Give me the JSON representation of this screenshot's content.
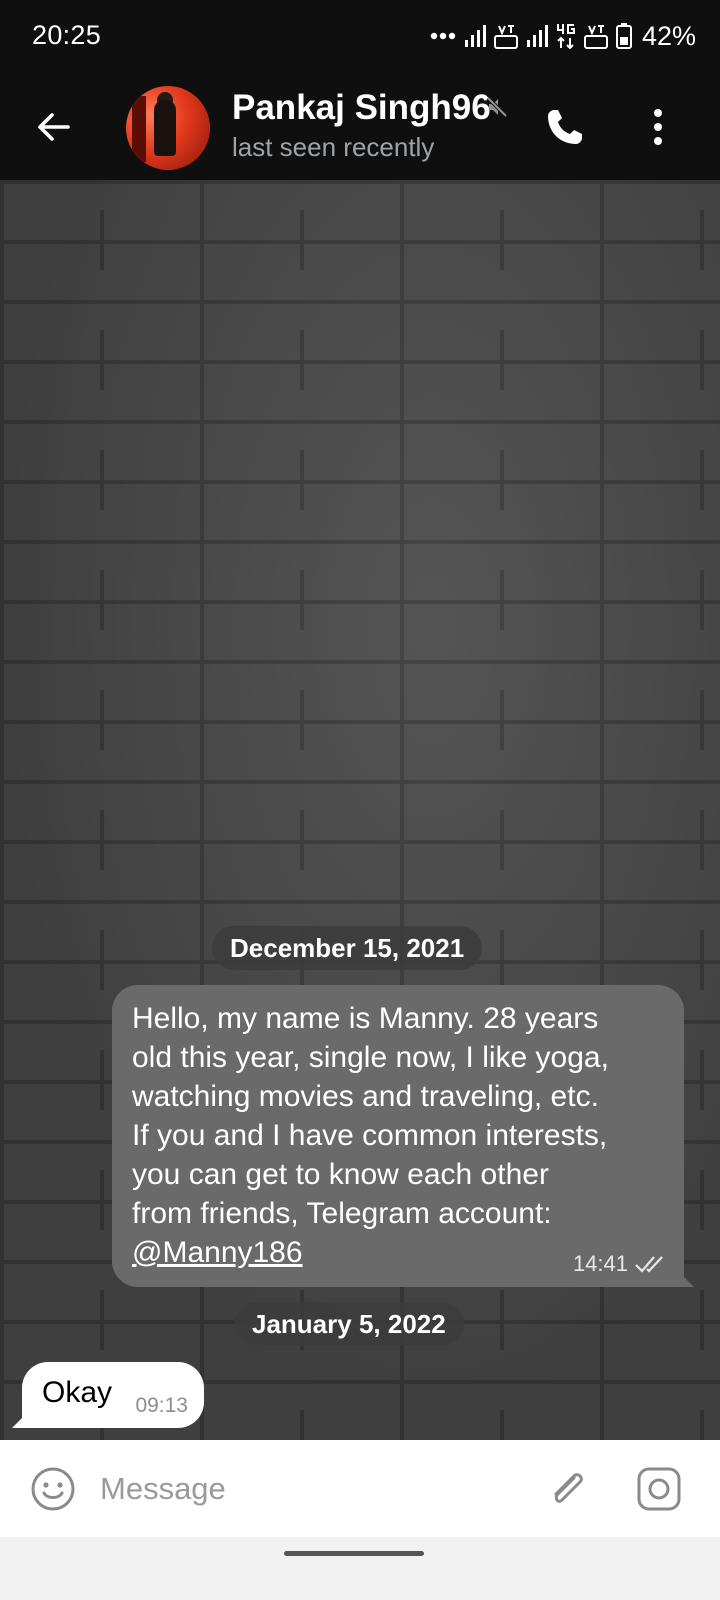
{
  "status_bar": {
    "time": "20:25",
    "battery": "42%",
    "icons": [
      "more-dots-icon",
      "signal-icon",
      "volte-icon",
      "signal-icon",
      "4g-icon",
      "volte-icon",
      "battery-icon"
    ]
  },
  "header": {
    "contact_name": "Pankaj Singh96",
    "status": "last seen recently",
    "icons": [
      "back-arrow-icon",
      "muted-icon",
      "phone-icon",
      "more-vert-icon"
    ]
  },
  "chat": {
    "date_1": "December 15, 2021",
    "outgoing_message": {
      "lines": [
        "Hello, my name is Manny. 28 years",
        "old this year, single now, I like yoga,",
        "watching movies and traveling, etc.",
        "If you and I have common interests,",
        "you can get to know each other",
        "from friends, Telegram account:"
      ],
      "mention": "@Manny186",
      "time": "14:41",
      "status": "read"
    },
    "date_2": "January 5, 2022",
    "incoming_message": {
      "text": "Okay",
      "time": "09:13"
    }
  },
  "composer": {
    "placeholder": "Message",
    "value": "",
    "icons": [
      "emoji-icon",
      "attach-icon",
      "camera-icon"
    ]
  },
  "colors": {
    "bar_background": "#0f0f0f",
    "outgoing_bubble": "#6a6a6a",
    "incoming_bubble": "#ffffff",
    "muted_text": "#9ea3a8"
  }
}
